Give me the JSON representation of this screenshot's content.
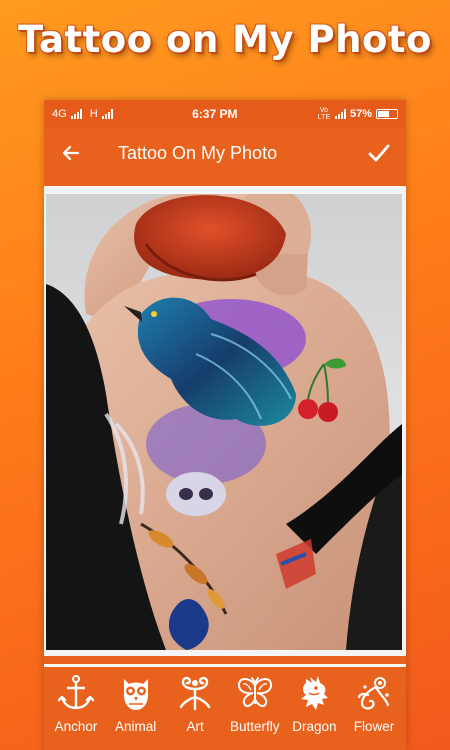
{
  "promo": {
    "title": "Tattoo on My Photo"
  },
  "status_bar": {
    "network_left": "4G",
    "network_mid": "H",
    "time": "6:37 PM",
    "volte": "Vo LTE",
    "battery": "57%"
  },
  "toolbar": {
    "back_icon": "arrow-left-icon",
    "title": "Tattoo On My Photo",
    "confirm_icon": "checkmark-icon"
  },
  "categories": [
    {
      "label": "Anchor",
      "icon": "anchor-icon"
    },
    {
      "label": "Animal",
      "icon": "owl-icon"
    },
    {
      "label": "Art",
      "icon": "tribal-swirl-icon"
    },
    {
      "label": "Butterfly",
      "icon": "butterfly-icon"
    },
    {
      "label": "Dragon",
      "icon": "dragon-icon"
    },
    {
      "label": "Flower",
      "icon": "flower-swirl-icon"
    }
  ],
  "colors": {
    "accent": "#e8621d",
    "status_bar": "#e65a1a",
    "background_top": "#ff9a1f",
    "background_bottom": "#f25a1c"
  }
}
